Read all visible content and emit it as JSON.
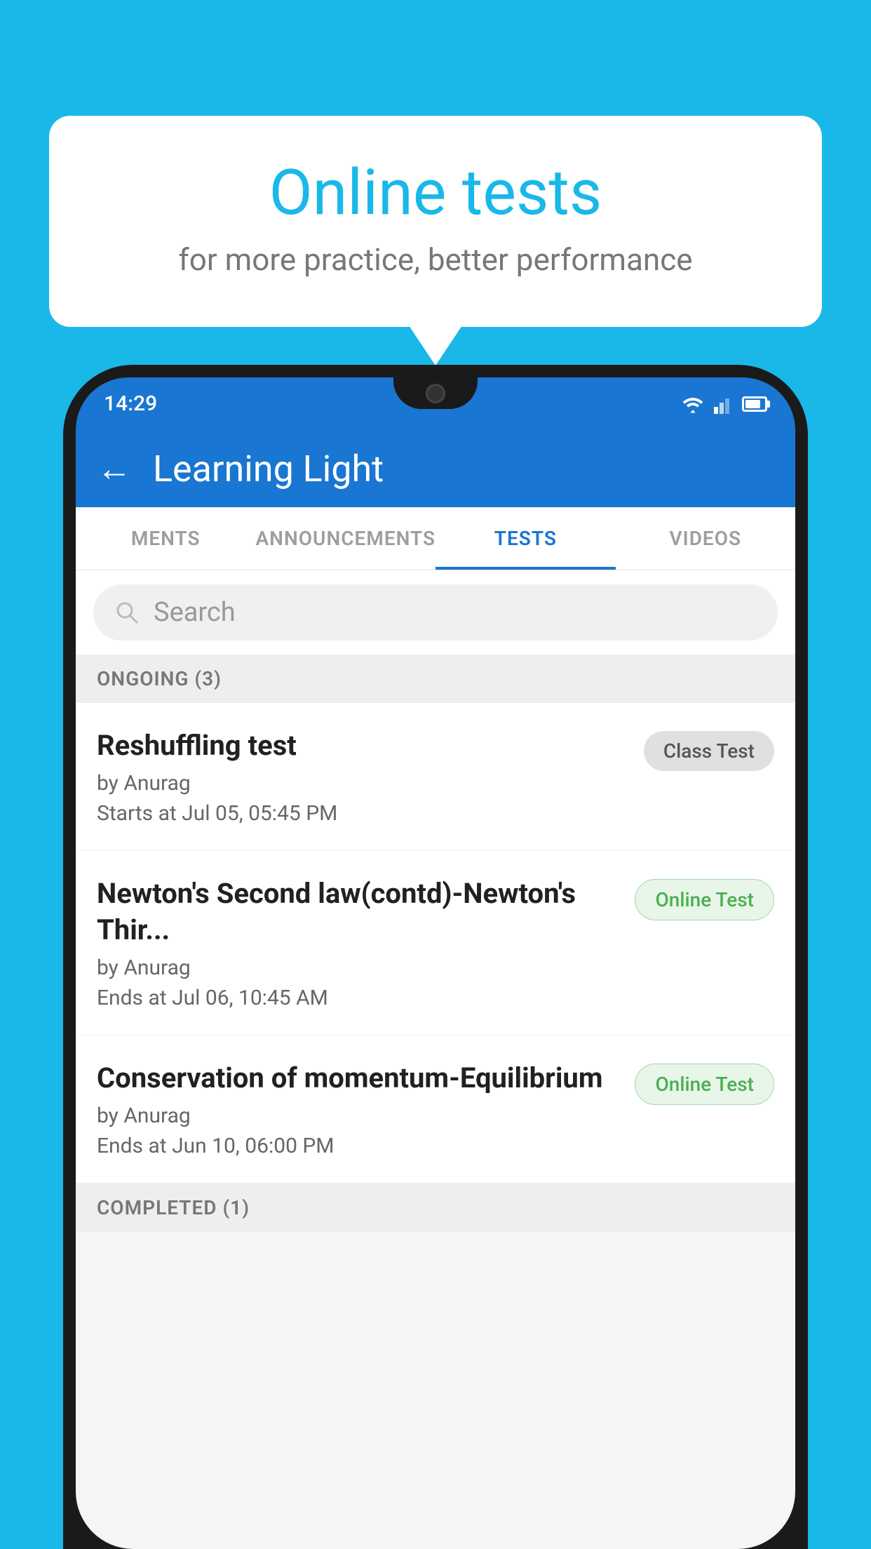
{
  "background": {
    "color": "#1ab8e8"
  },
  "speech_bubble": {
    "title": "Online tests",
    "subtitle": "for more practice, better performance"
  },
  "phone": {
    "status_bar": {
      "time": "14:29",
      "wifi_icon": "wifi-icon",
      "signal_icon": "signal-icon",
      "battery_icon": "battery-icon"
    },
    "app_bar": {
      "back_label": "←",
      "title": "Learning Light"
    },
    "tabs": [
      {
        "label": "MENTS",
        "active": false
      },
      {
        "label": "ANNOUNCEMENTS",
        "active": false
      },
      {
        "label": "TESTS",
        "active": true
      },
      {
        "label": "VIDEOS",
        "active": false
      }
    ],
    "search": {
      "placeholder": "Search"
    },
    "ongoing_section": {
      "header": "ONGOING (3)",
      "tests": [
        {
          "name": "Reshuffling test",
          "author": "by Anurag",
          "time_label": "Starts at",
          "time": "Jul 05, 05:45 PM",
          "badge": "Class Test",
          "badge_type": "class"
        },
        {
          "name": "Newton's Second law(contd)-Newton's Thir...",
          "author": "by Anurag",
          "time_label": "Ends at",
          "time": "Jul 06, 10:45 AM",
          "badge": "Online Test",
          "badge_type": "online"
        },
        {
          "name": "Conservation of momentum-Equilibrium",
          "author": "by Anurag",
          "time_label": "Ends at",
          "time": "Jun 10, 06:00 PM",
          "badge": "Online Test",
          "badge_type": "online"
        }
      ]
    },
    "completed_section": {
      "header": "COMPLETED (1)"
    }
  }
}
